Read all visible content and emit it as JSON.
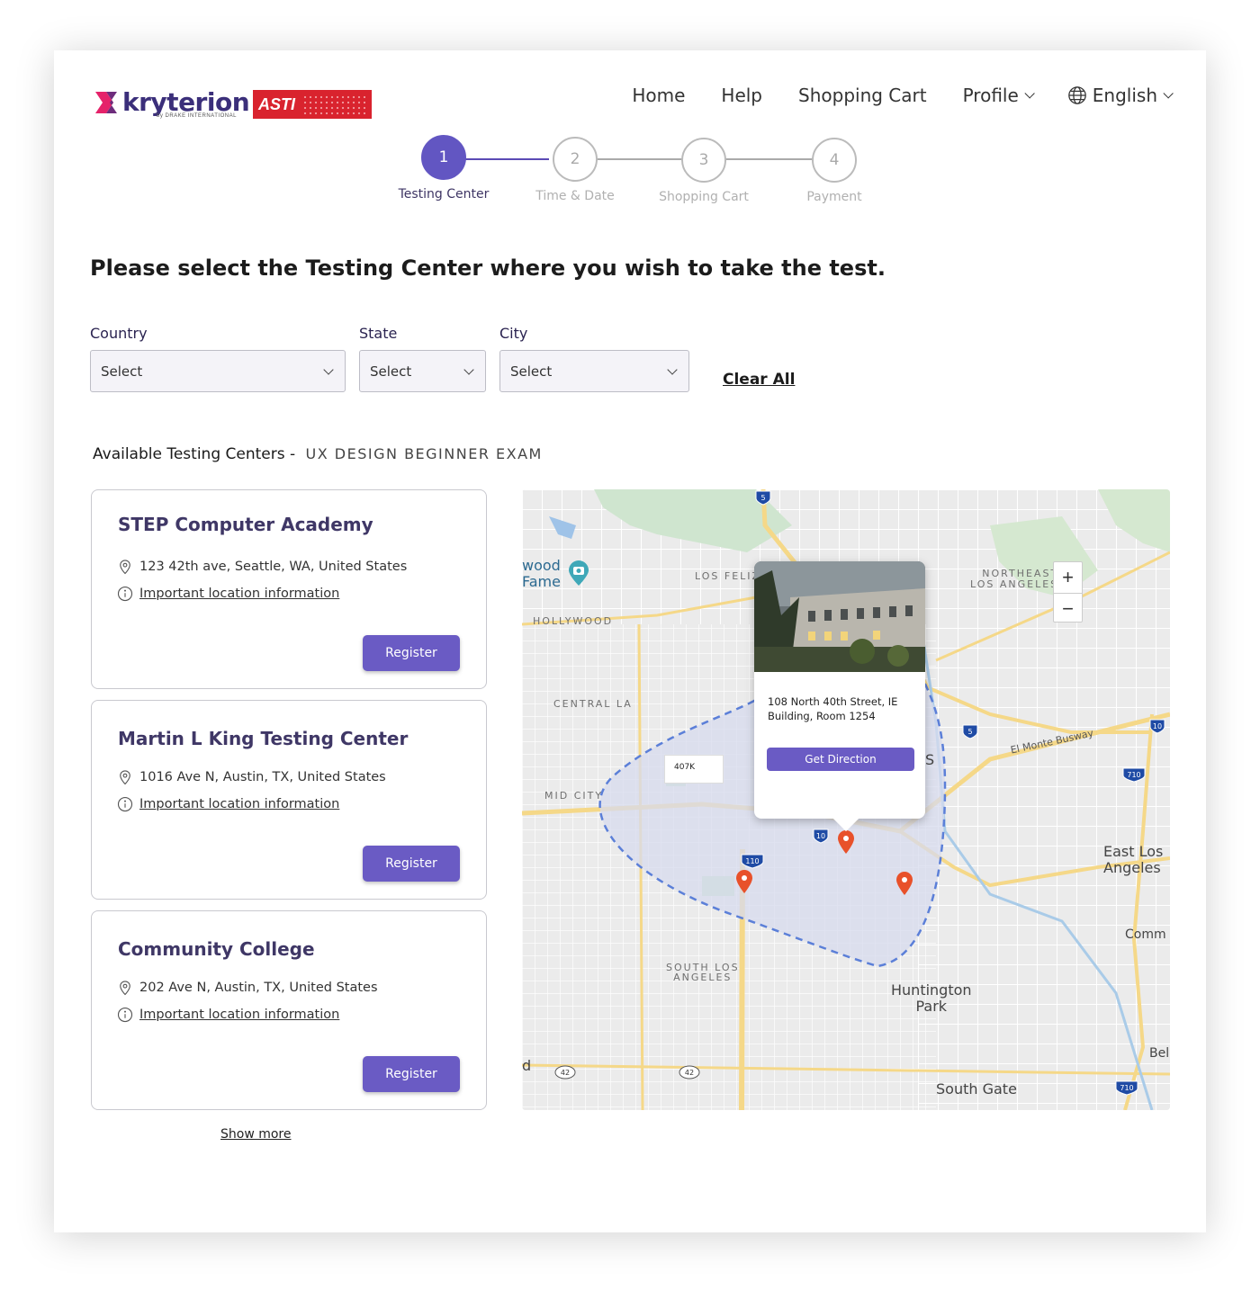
{
  "brand": {
    "kryterion": "kryterion",
    "kryterion_sub": "by DRAKE INTERNATIONAL",
    "asti": "ASTI"
  },
  "nav": {
    "home": "Home",
    "help": "Help",
    "cart": "Shopping Cart",
    "profile": "Profile",
    "language": "English"
  },
  "stepper": [
    {
      "num": "1",
      "label": "Testing Center"
    },
    {
      "num": "2",
      "label": "Time & Date"
    },
    {
      "num": "3",
      "label": "Shopping Cart"
    },
    {
      "num": "4",
      "label": "Payment"
    }
  ],
  "page_title": "Please select the Testing Center where you wish to take the test.",
  "filters": {
    "country": {
      "label": "Country",
      "value": "Select"
    },
    "state": {
      "label": "State",
      "value": "Select"
    },
    "city": {
      "label": "City",
      "value": "Select"
    },
    "clear_all": "Clear All"
  },
  "available": {
    "label": "Available Testing Centers -",
    "exam": "UX DESIGN BEGINNER EXAM"
  },
  "centers": [
    {
      "name": "STEP Computer Academy",
      "address": "123 42th ave, Seattle, WA, United States",
      "info": "Important location information",
      "register": "Register"
    },
    {
      "name": "Martin L King Testing Center",
      "address": "1016 Ave N, Austin, TX, United States",
      "info": "Important location information",
      "register": "Register"
    },
    {
      "name": "Community College",
      "address": "202 Ave N, Austin, TX, United States",
      "info": "Important location information",
      "register": "Register"
    }
  ],
  "show_more": "Show more",
  "map": {
    "popup_address": "108 North 40th Street, IE Building, Room 1254",
    "get_direction": "Get Direction",
    "tooltip": "407K",
    "zoom_in": "+",
    "zoom_out": "−",
    "labels": {
      "wood_fame": "wood\nFame",
      "los_feliz": "LOS FELIZ",
      "northeast": "NORTHEAST\nLOS ANGELES",
      "hollywood": "HOLLYWOOD",
      "central_la": "CENTRAL LA",
      "mid_city": "MID CITY",
      "el_monte": "El Monte Busway",
      "east_los": "East Los\nAngeles",
      "comm": "Comm",
      "south_los": "SOUTH LOS\nANGELES",
      "huntington": "Huntington\nPark",
      "bel": "Bel",
      "south_gate": "South Gate",
      "s_frag": "S",
      "d_frag": "d"
    },
    "shields": [
      "5",
      "10",
      "110",
      "5",
      "10",
      "710",
      "42",
      "42",
      "710"
    ]
  },
  "colors": {
    "accent": "#6a5bc4",
    "accent_dark": "#3f3766",
    "pin": "#e8512a",
    "area": "#5b7fd8"
  }
}
